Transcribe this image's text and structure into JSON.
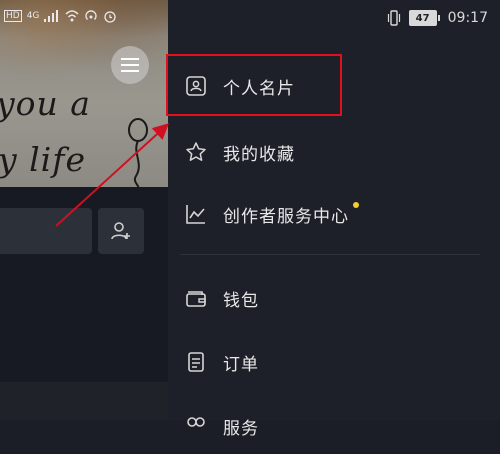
{
  "status_bar": {
    "left_items": [
      "4G",
      "HD"
    ],
    "battery_level": "47",
    "time": "09:17"
  },
  "profile_background": {
    "cover_text_line1": "you a",
    "cover_text_line2": "y life"
  },
  "drawer": {
    "items": [
      {
        "label": "个人名片",
        "icon": "id-card-icon"
      },
      {
        "label": "我的收藏",
        "icon": "star-icon"
      },
      {
        "label": "创作者服务中心",
        "icon": "chart-line-icon",
        "badge_dot": true
      },
      {
        "label": "钱包",
        "icon": "wallet-icon"
      },
      {
        "label": "订单",
        "icon": "order-doc-icon"
      },
      {
        "label": "服务",
        "icon": "services-icon"
      }
    ]
  },
  "colors": {
    "drawer_bg": "#1d2029",
    "highlight_box": "#e0101e",
    "badge_dot": "#f6cc2c",
    "text": "#e8e8e8"
  }
}
